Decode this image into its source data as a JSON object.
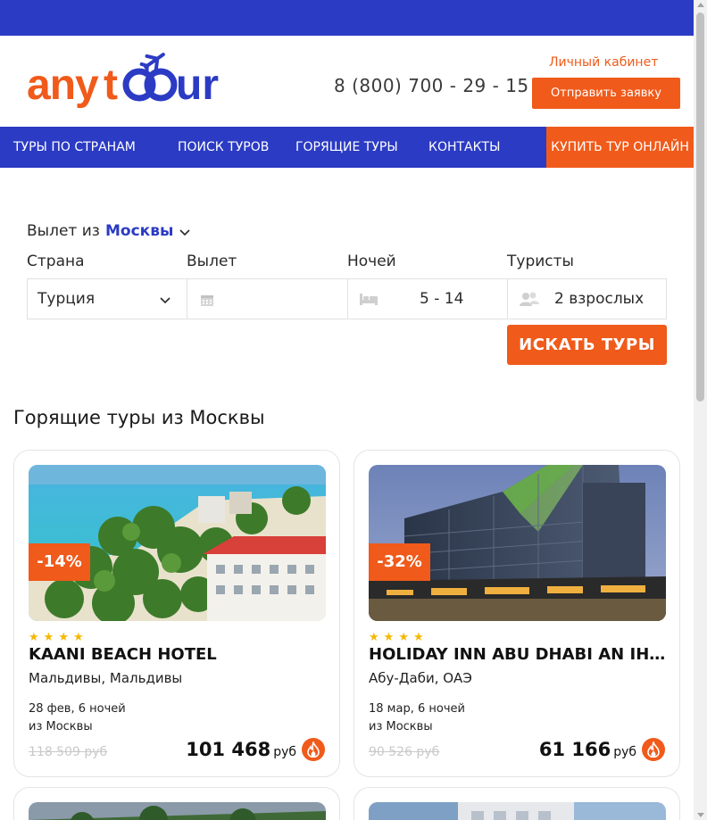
{
  "header": {
    "logo_text": "anytour",
    "phone": "8 (800) 700 - 29 - 15",
    "cabinet_link": "Личный кабинет",
    "send_request_button": "Отправить заявку"
  },
  "nav": {
    "items": [
      {
        "label": "ТУРЫ ПО СТРАНАМ"
      },
      {
        "label": "ПОИСК ТУРОВ"
      },
      {
        "label": "ГОРЯЩИЕ ТУРЫ"
      },
      {
        "label": "КОНТАКТЫ"
      }
    ],
    "buy_online": "КУПИТЬ ТУР ОНЛАЙН"
  },
  "search": {
    "departure_label": "Вылет из",
    "departure_city": "Москвы",
    "country_label": "Страна",
    "country_value": "Турция",
    "date_label": "Вылет",
    "date_value": "",
    "nights_label": "Ночей",
    "nights_value": "5 - 14",
    "tourists_label": "Туристы",
    "tourists_value": "2 взрослых",
    "search_button": "ИСКАТЬ ТУРЫ"
  },
  "hot_tours": {
    "title": "Горящие туры из Москвы",
    "cards": [
      {
        "discount": "-14%",
        "stars": 4,
        "hotel": "KAANI BEACH HOTEL",
        "location": "Мальдивы, Мальдивы",
        "dates": "28 фев, 6 ночей",
        "from": "из Москвы",
        "old_price": "118 509 руб",
        "price": "101 468",
        "currency": "руб",
        "image_icon": "beach-hotel-photo"
      },
      {
        "discount": "-32%",
        "stars": 4,
        "hotel": "HOLIDAY INN ABU DHABI AN IHG ...",
        "location": "Абу-Даби, ОАЭ",
        "dates": "18 мар, 6 ночей",
        "from": "из Москвы",
        "old_price": "90 526 руб",
        "price": "61 166",
        "currency": "руб",
        "image_icon": "city-hotel-photo"
      }
    ]
  },
  "colors": {
    "brand_blue": "#2b3bc4",
    "brand_orange": "#f05a1a",
    "star_yellow": "#f5b800"
  }
}
